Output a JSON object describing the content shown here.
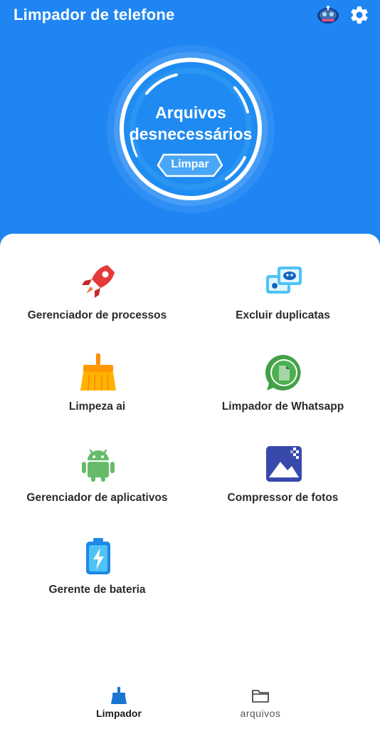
{
  "header": {
    "title": "Limpador de telefone",
    "icons": [
      "robot-icon",
      "gear-icon"
    ],
    "background": "#1f85f2"
  },
  "junk_card": {
    "title": "Arquivos desnecessários",
    "button_label": "Limpar"
  },
  "tools": [
    {
      "label": "Gerenciador de processos",
      "icon": "rocket-icon"
    },
    {
      "label": "Excluir duplicatas",
      "icon": "duplicate-icon"
    },
    {
      "label": "Limpeza ai",
      "icon": "broom-icon"
    },
    {
      "label": "Limpador de Whatsapp",
      "icon": "whatsapp-icon"
    },
    {
      "label": "Gerenciador de aplicativos",
      "icon": "android-icon"
    },
    {
      "label": "Compressor de fotos",
      "icon": "photo-icon"
    },
    {
      "label": "Gerente de bateria",
      "icon": "battery-icon"
    }
  ],
  "bottom_nav": {
    "items": [
      {
        "label": "Limpador",
        "icon": "broom-icon",
        "active": true
      },
      {
        "label": "arquivos",
        "icon": "folder-icon",
        "active": false
      }
    ]
  }
}
